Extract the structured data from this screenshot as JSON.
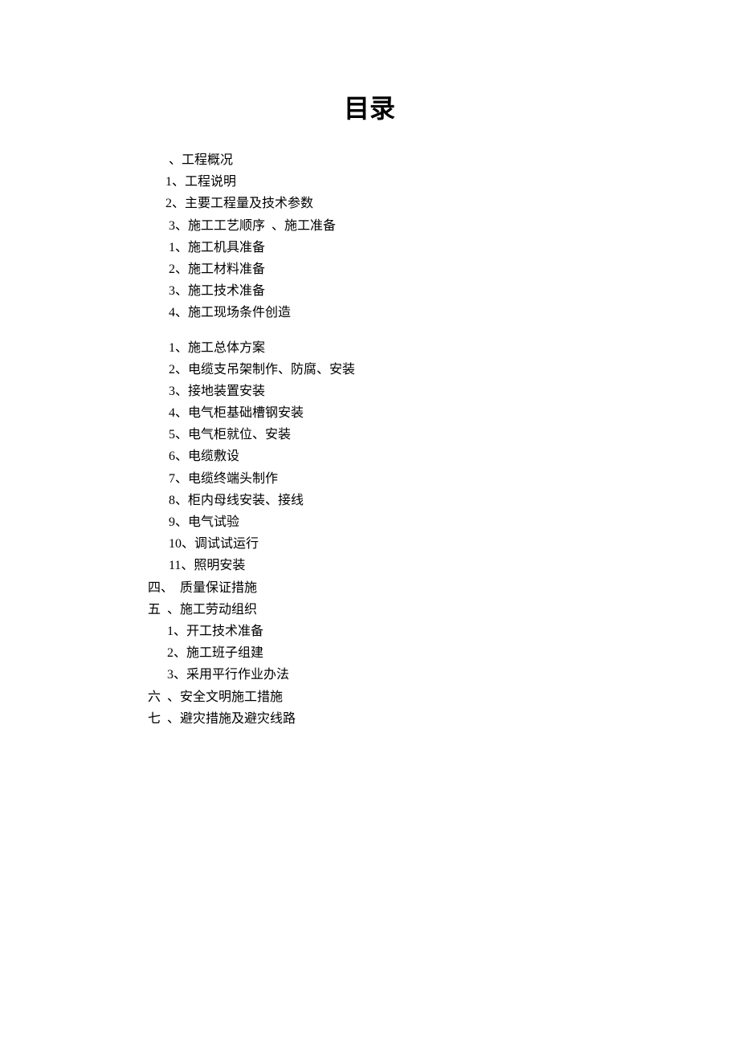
{
  "title": "目录",
  "items": [
    {
      "text": " 、工程概况",
      "indent": "indent-1"
    },
    {
      "text": "1、工程说明",
      "indent": "indent-1"
    },
    {
      "text": "2、主要工程量及技术参数",
      "indent": "indent-1"
    },
    {
      "text": " 3、施工工艺顺序  、施工准备",
      "indent": "indent-1"
    },
    {
      "text": " 1、施工机具准备",
      "indent": "indent-1"
    },
    {
      "text": " 2、施工材料准备",
      "indent": "indent-1"
    },
    {
      "text": " 3、施工技术准备",
      "indent": "indent-1"
    },
    {
      "text": " 4、施工现场条件创造",
      "indent": "indent-1"
    },
    {
      "text": "",
      "indent": "spacer"
    },
    {
      "text": " 1、施工总体方案",
      "indent": "indent-1"
    },
    {
      "text": " 2、电缆支吊架制作、防腐、安装",
      "indent": "indent-1"
    },
    {
      "text": " 3、接地装置安装",
      "indent": "indent-1"
    },
    {
      "text": " 4、电气柜基础槽钢安装",
      "indent": "indent-1"
    },
    {
      "text": " 5、电气柜就位、安装",
      "indent": "indent-1"
    },
    {
      "text": " 6、电缆敷设",
      "indent": "indent-1"
    },
    {
      "text": " 7、电缆终端头制作",
      "indent": "indent-1"
    },
    {
      "text": " 8、柜内母线安装、接线",
      "indent": "indent-1"
    },
    {
      "text": " 9、电气试验",
      "indent": "indent-1"
    },
    {
      "text": " 10、调试试运行",
      "indent": "indent-1"
    },
    {
      "text": " 11、照明安装",
      "indent": "indent-1"
    },
    {
      "text": "四、  质量保证措施",
      "indent": "indent-0"
    },
    {
      "text": "五  、施工劳动组织",
      "indent": "indent-0"
    },
    {
      "text": "1、开工技术准备",
      "indent": "indent-2"
    },
    {
      "text": "2、施工班子组建",
      "indent": "indent-2"
    },
    {
      "text": "3、采用平行作业办法",
      "indent": "indent-2"
    },
    {
      "text": "六  、安全文明施工措施",
      "indent": "indent-0"
    },
    {
      "text": "七  、避灾措施及避灾线路",
      "indent": "indent-0"
    }
  ]
}
